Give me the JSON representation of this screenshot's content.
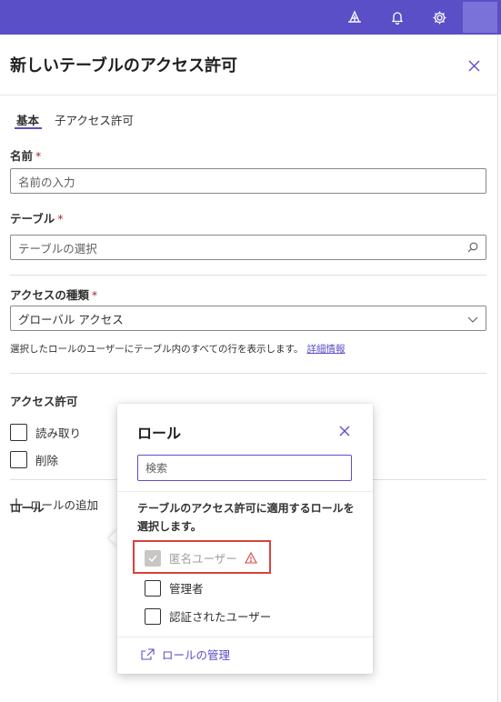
{
  "panel": {
    "title": "新しいテーブルのアクセス許可",
    "tabs": [
      {
        "label": "基本",
        "active": true
      },
      {
        "label": "子アクセス許可",
        "active": false
      }
    ]
  },
  "form": {
    "name": {
      "label": "名前",
      "required_mark": "*",
      "placeholder": "名前の入力"
    },
    "table": {
      "label": "テーブル",
      "required_mark": "*",
      "placeholder": "テーブルの選択"
    },
    "access_type": {
      "label": "アクセスの種類",
      "required_mark": "*",
      "selected": "グローバル アクセス",
      "hint": "選択したロールのユーザーにテーブル内のすべての行を表示します。",
      "learn_more": "詳細情報"
    },
    "permissions": {
      "label": "アクセス許可",
      "items": [
        {
          "label": "読み取り",
          "checked": false
        },
        {
          "label": "削除",
          "checked": false
        }
      ]
    },
    "roles": {
      "label": "ロール",
      "add_label": "ロールの追加"
    }
  },
  "callout": {
    "title": "ロール",
    "search_placeholder": "検索",
    "description": "テーブルのアクセス許可に適用するロールを選択します。",
    "roles": [
      {
        "label": "匿名ユーザー",
        "checked": true,
        "disabled": true,
        "warning": true
      },
      {
        "label": "管理者",
        "checked": false,
        "disabled": false
      },
      {
        "label": "認証されたユーザー",
        "checked": false,
        "disabled": false
      }
    ],
    "manage_label": "ロールの管理"
  },
  "colors": {
    "accent": "#5b4fc7",
    "required": "#a4262c",
    "warning": "#d9413b"
  }
}
